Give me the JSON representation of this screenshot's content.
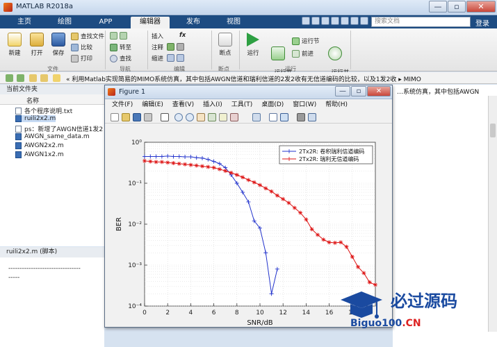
{
  "app": {
    "title": "MATLAB R2018a",
    "window_buttons": {
      "minimize": "—",
      "maximize": "▫",
      "close": "✕"
    }
  },
  "ribbon_tabs": [
    {
      "label": "主页",
      "active": false
    },
    {
      "label": "绘图",
      "active": false
    },
    {
      "label": "APP",
      "active": false
    },
    {
      "label": "编辑器",
      "active": true
    },
    {
      "label": "发布",
      "active": false
    },
    {
      "label": "视图",
      "active": false
    }
  ],
  "search": {
    "placeholder": "搜索文档"
  },
  "login_label": "登录",
  "ribbon": {
    "file": {
      "new": "新建",
      "open": "打开",
      "save": "保存",
      "find_files": "查找文件",
      "compare": "比较",
      "print": "打印",
      "group": "文件"
    },
    "navigate": {
      "goto": "转至",
      "find": "查找",
      "group": "导航"
    },
    "edit": {
      "insert": "插入",
      "comment": "注释",
      "indent": "缩进",
      "fx": "fx",
      "group": "编辑"
    },
    "breakpoints": {
      "breakpoint": "断点",
      "group": "断点"
    },
    "run": {
      "run": "运行",
      "run_advance": "运行并\n前进",
      "run_section": "运行节",
      "advance": "前进",
      "run_time": "运行并\n计时",
      "group": "运行"
    }
  },
  "address": {
    "path": "«  利用Matlab实现简易的MIMO系统仿真，其中包括AWGN信道和瑞利信道的2发2收有无信道编码的比较，以及1发2收  ▸  MIMO"
  },
  "current_folder": {
    "title": "当前文件夹",
    "column": "名称",
    "files": [
      {
        "name": "各个程序说明.txt",
        "type": "txt",
        "selected": false
      },
      {
        "name": "ruili2x2.m",
        "type": "m",
        "selected": true
      },
      {
        "name": "ps：新增了AWGN信道1发2",
        "type": "txt",
        "selected": false
      },
      {
        "name": "AWGN_same_data.m",
        "type": "m",
        "selected": false
      },
      {
        "name": "AWGN2x2.m",
        "type": "m",
        "selected": false
      },
      {
        "name": "AWGN1x2.m",
        "type": "m",
        "selected": false
      }
    ]
  },
  "details": {
    "title": "ruili2x2.m  (脚本)",
    "lines": [
      "--------------------------------",
      "-----"
    ]
  },
  "editor_snippet": "…系统仿真，其中包括AWGN",
  "figure": {
    "title": "Figure 1",
    "menu": [
      "文件(F)",
      "编辑(E)",
      "查看(V)",
      "插入(I)",
      "工具(T)",
      "桌面(D)",
      "窗口(W)",
      "帮助(H)"
    ]
  },
  "chart_data": {
    "type": "line",
    "xlabel": "SNR/dB",
    "ylabel": "BER",
    "yscale": "log",
    "xlim": [
      0,
      20
    ],
    "ylim": [
      0.0001,
      1
    ],
    "xticks": [
      "0",
      "2",
      "4",
      "6",
      "8",
      "10",
      "12",
      "14",
      "16",
      "18"
    ],
    "yticks": [
      "10⁰",
      "10⁻¹",
      "10⁻²",
      "10⁻³",
      "10⁻⁴"
    ],
    "grid": true,
    "legend_position": "top-right",
    "series": [
      {
        "name": "2Tx2R: 卷积瑞利信道编码",
        "color": "#2233cc",
        "marker": "+",
        "x": [
          0,
          0.5,
          1,
          1.5,
          2,
          2.5,
          3,
          3.5,
          4,
          4.5,
          5,
          5.5,
          6,
          6.5,
          7,
          7.5,
          8,
          8.5,
          9,
          9.5,
          10,
          10.5,
          11,
          11.5
        ],
        "y": [
          0.45,
          0.45,
          0.45,
          0.45,
          0.46,
          0.45,
          0.45,
          0.44,
          0.44,
          0.42,
          0.41,
          0.38,
          0.34,
          0.3,
          0.24,
          0.16,
          0.1,
          0.06,
          0.035,
          0.012,
          0.008,
          0.002,
          0.0002,
          0.0008
        ]
      },
      {
        "name": "2Tx2R: 瑞利无信道编码",
        "color": "#dd1111",
        "marker": "*",
        "x": [
          0,
          0.5,
          1,
          1.5,
          2,
          2.5,
          3,
          3.5,
          4,
          4.5,
          5,
          5.5,
          6,
          6.5,
          7,
          7.5,
          8,
          8.5,
          9,
          9.5,
          10,
          10.5,
          11,
          11.5,
          12,
          12.5,
          13,
          13.5,
          14,
          14.5,
          15,
          15.5,
          16,
          16.5,
          17,
          17.5,
          18,
          18.5,
          19,
          19.5,
          20
        ],
        "y": [
          0.35,
          0.34,
          0.33,
          0.33,
          0.32,
          0.31,
          0.3,
          0.29,
          0.28,
          0.27,
          0.26,
          0.25,
          0.24,
          0.22,
          0.2,
          0.18,
          0.16,
          0.14,
          0.12,
          0.105,
          0.09,
          0.075,
          0.063,
          0.05,
          0.041,
          0.033,
          0.025,
          0.019,
          0.013,
          0.0075,
          0.0055,
          0.0042,
          0.0036,
          0.0035,
          0.0036,
          0.0028,
          0.0016,
          0.0009,
          0.00064,
          0.00038,
          0.00033
        ]
      }
    ]
  },
  "watermark": {
    "title": "必过源码",
    "subtitle": "Biguo100",
    "domain_suffix": ".CN"
  },
  "colors": {
    "tab_bar": "#1d4c82",
    "series1": "#2233cc",
    "series2": "#dd1111",
    "watermark_blue": "#1a4aa0",
    "watermark_red": "#dd2222"
  },
  "icons": [
    "new-icon",
    "open-icon",
    "save-icon",
    "run-icon",
    "breakpoint-icon",
    "zoom-in-icon",
    "zoom-out-icon",
    "pan-icon"
  ]
}
